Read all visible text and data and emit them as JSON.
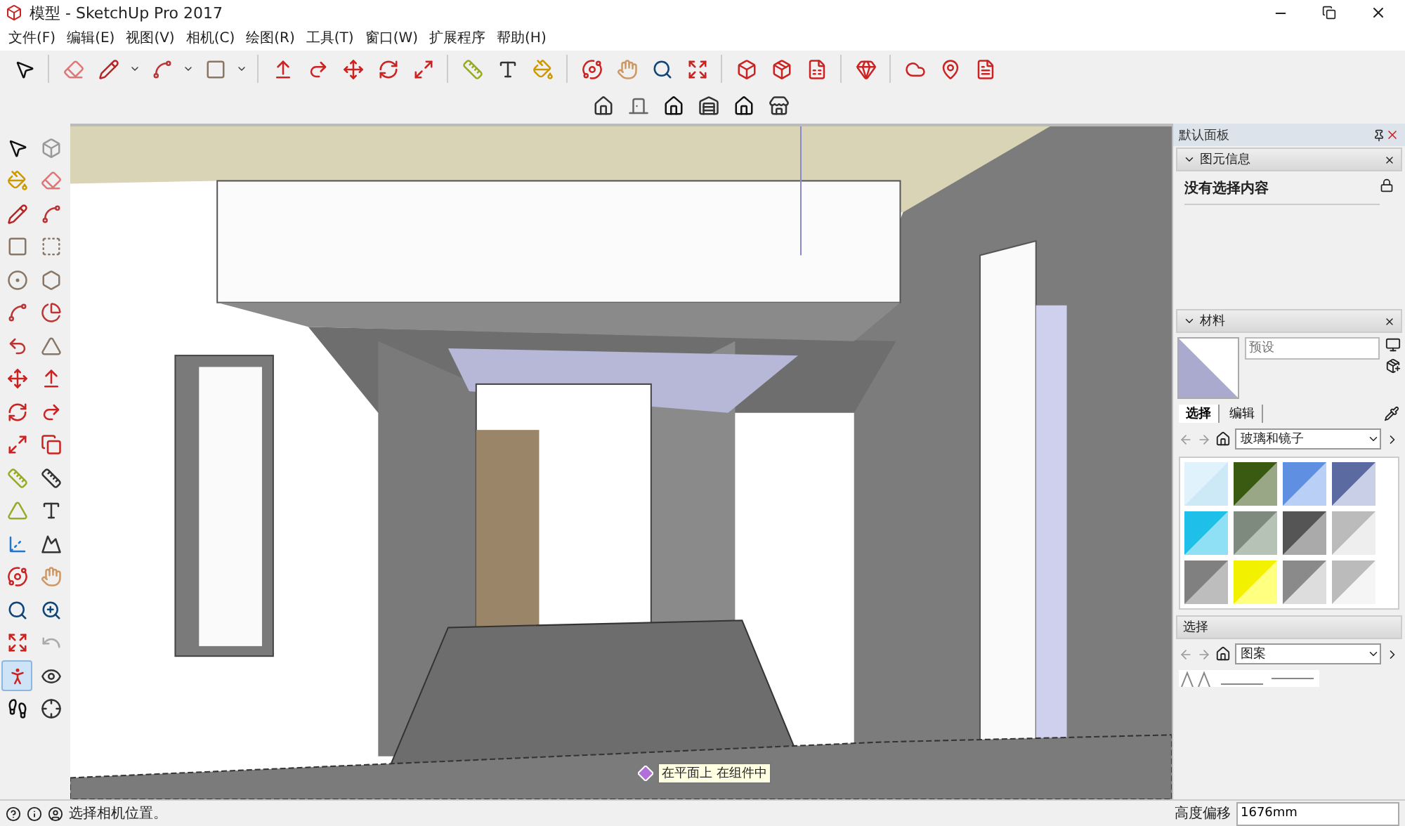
{
  "window": {
    "title": "模型 - SketchUp Pro 2017"
  },
  "menu": [
    "文件(F)",
    "编辑(E)",
    "视图(V)",
    "相机(C)",
    "绘图(R)",
    "工具(T)",
    "窗口(W)",
    "扩展程序",
    "帮助(H)"
  ],
  "left_tools": [
    {
      "selected": false
    },
    {
      "selected": false
    },
    {
      "selected": false
    },
    {
      "selected": false
    },
    {
      "selected": false
    },
    {
      "selected": false
    },
    {
      "selected": false
    },
    {
      "selected": false
    },
    {
      "selected": false
    },
    {
      "selected": false
    },
    {
      "selected": false
    },
    {
      "selected": false
    },
    {
      "selected": false
    },
    {
      "selected": false
    },
    {
      "selected": false
    },
    {
      "selected": false
    },
    {
      "selected": false
    },
    {
      "selected": false
    },
    {
      "selected": false
    },
    {
      "selected": false
    },
    {
      "selected": false
    },
    {
      "selected": false
    },
    {
      "selected": false
    },
    {
      "selected": false
    },
    {
      "selected": false
    },
    {
      "selected": false
    },
    {
      "selected": false
    },
    {
      "selected": false
    },
    {
      "selected": false
    },
    {
      "selected": false
    },
    {
      "selected": false
    },
    {
      "selected": false
    },
    {
      "selected": true
    },
    {
      "selected": false
    },
    {
      "selected": false
    },
    {
      "selected": false
    }
  ],
  "viewport": {
    "tooltip": "在平面上 在组件中"
  },
  "panel": {
    "title": "默认面板",
    "entity_info": {
      "title": "图元信息",
      "text": "没有选择内容"
    },
    "materials": {
      "title": "材料",
      "name_placeholder": "预设",
      "tabs": [
        {
          "label": "选择",
          "selected": true
        },
        {
          "label": "编辑",
          "selected": false
        }
      ],
      "collection": "玻璃和镜子"
    },
    "secondary": {
      "title": "选择",
      "collection": "图案"
    }
  },
  "status_bar": {
    "message": "选择相机位置。",
    "measure_label": "高度偏移",
    "measure_value": "1676mm"
  }
}
